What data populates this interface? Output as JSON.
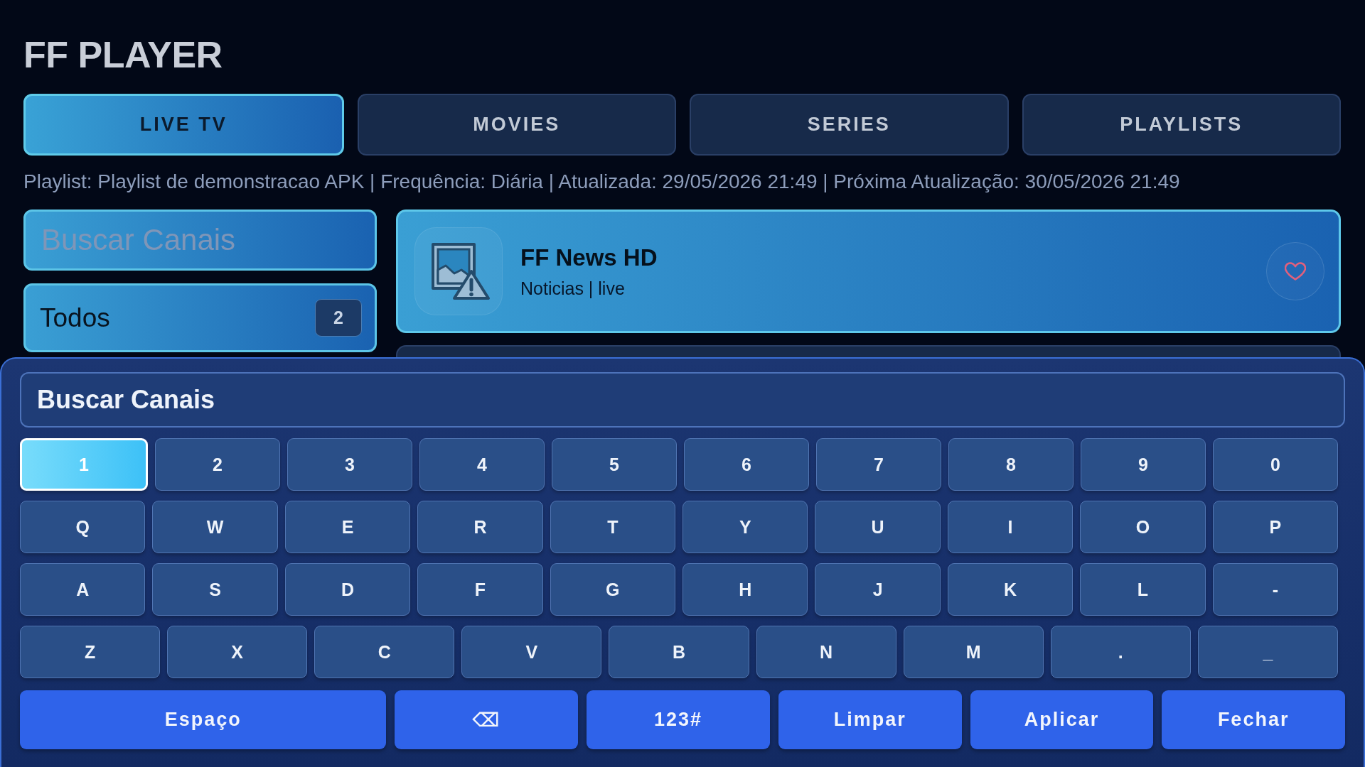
{
  "app": {
    "title": "FF PLAYER"
  },
  "tabs": [
    {
      "label": "LIVE TV",
      "selected": true
    },
    {
      "label": "MOVIES",
      "selected": false
    },
    {
      "label": "SERIES",
      "selected": false
    },
    {
      "label": "PLAYLISTS",
      "selected": false
    }
  ],
  "playlist_info": "Playlist: Playlist de demonstracao APK | Frequência: Diária | Atualizada: 29/05/2026 21:49 | Próxima Atualização: 30/05/2026 21:49",
  "search": {
    "placeholder": "Buscar Canais",
    "focused": true
  },
  "categories": [
    {
      "label": "Todos",
      "count": "2",
      "selected": true
    }
  ],
  "channels": [
    {
      "name": "FF News HD",
      "meta": "Noticias | live",
      "selected": true,
      "favorite": false
    },
    {
      "selected": false
    }
  ],
  "keyboard": {
    "prompt": "Buscar Canais",
    "rows": [
      [
        {
          "label": "1",
          "selected": true
        },
        {
          "label": "2",
          "selected": false
        },
        {
          "label": "3",
          "selected": false
        },
        {
          "label": "4",
          "selected": false
        },
        {
          "label": "5",
          "selected": false
        },
        {
          "label": "6",
          "selected": false
        },
        {
          "label": "7",
          "selected": false
        },
        {
          "label": "8",
          "selected": false
        },
        {
          "label": "9",
          "selected": false
        },
        {
          "label": "0",
          "selected": false
        }
      ],
      [
        {
          "label": "Q",
          "selected": false
        },
        {
          "label": "W",
          "selected": false
        },
        {
          "label": "E",
          "selected": false
        },
        {
          "label": "R",
          "selected": false
        },
        {
          "label": "T",
          "selected": false
        },
        {
          "label": "Y",
          "selected": false
        },
        {
          "label": "U",
          "selected": false
        },
        {
          "label": "I",
          "selected": false
        },
        {
          "label": "O",
          "selected": false
        },
        {
          "label": "P",
          "selected": false
        }
      ],
      [
        {
          "label": "A",
          "selected": false
        },
        {
          "label": "S",
          "selected": false
        },
        {
          "label": "D",
          "selected": false
        },
        {
          "label": "F",
          "selected": false
        },
        {
          "label": "G",
          "selected": false
        },
        {
          "label": "H",
          "selected": false
        },
        {
          "label": "J",
          "selected": false
        },
        {
          "label": "K",
          "selected": false
        },
        {
          "label": "L",
          "selected": false
        },
        {
          "label": "-",
          "selected": false
        }
      ],
      [
        {
          "label": "Z",
          "selected": false
        },
        {
          "label": "X",
          "selected": false
        },
        {
          "label": "C",
          "selected": false
        },
        {
          "label": "V",
          "selected": false
        },
        {
          "label": "B",
          "selected": false
        },
        {
          "label": "N",
          "selected": false
        },
        {
          "label": "M",
          "selected": false
        },
        {
          "label": ".",
          "selected": false
        },
        {
          "label": "_",
          "selected": false
        }
      ]
    ],
    "actions": [
      {
        "label": "Espaço",
        "kind": "wide"
      },
      {
        "label": "⌫",
        "kind": "normal"
      },
      {
        "label": "123#",
        "kind": "normal"
      },
      {
        "label": "Limpar",
        "kind": "normal"
      },
      {
        "label": "Aplicar",
        "kind": "normal"
      },
      {
        "label": "Fechar",
        "kind": "normal"
      }
    ]
  }
}
